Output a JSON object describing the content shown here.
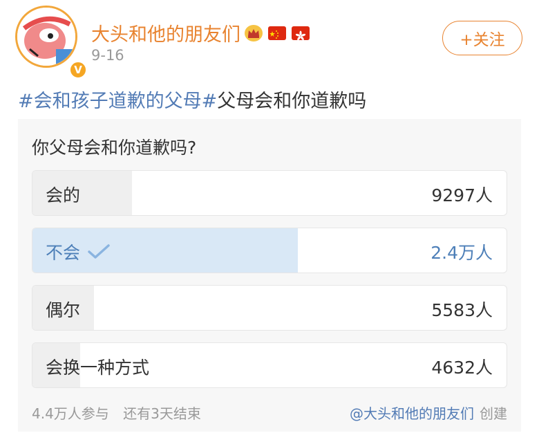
{
  "header": {
    "username": "大头和他的朋友们",
    "time": "9-16",
    "follow_label": "+关注",
    "verified_badge": "V",
    "badges": [
      "crown-icon",
      "china-flag-icon",
      "hongkong-flag-icon"
    ]
  },
  "post": {
    "topic": "#会和孩子道歉的父母#",
    "text": "父母会和你道歉吗"
  },
  "poll": {
    "question": "你父母会和你道歉吗?",
    "options": [
      {
        "label": "会的",
        "count": "9297人",
        "fraction": 0.21,
        "selected": false
      },
      {
        "label": "不会",
        "count": "2.4万人",
        "fraction": 0.56,
        "selected": true
      },
      {
        "label": "偶尔",
        "count": "5583人",
        "fraction": 0.13,
        "selected": false
      },
      {
        "label": "会换一种方式",
        "count": "4632人",
        "fraction": 0.1,
        "selected": false
      }
    ],
    "participants": "4.4万人参与",
    "remaining": "还有3天结束",
    "creator": "@大头和他的朋友们",
    "created_label": "创建"
  },
  "colors": {
    "accent_orange": "#e8832f",
    "link_blue": "#527bb5",
    "selected_fill": "#d9e8f6"
  }
}
